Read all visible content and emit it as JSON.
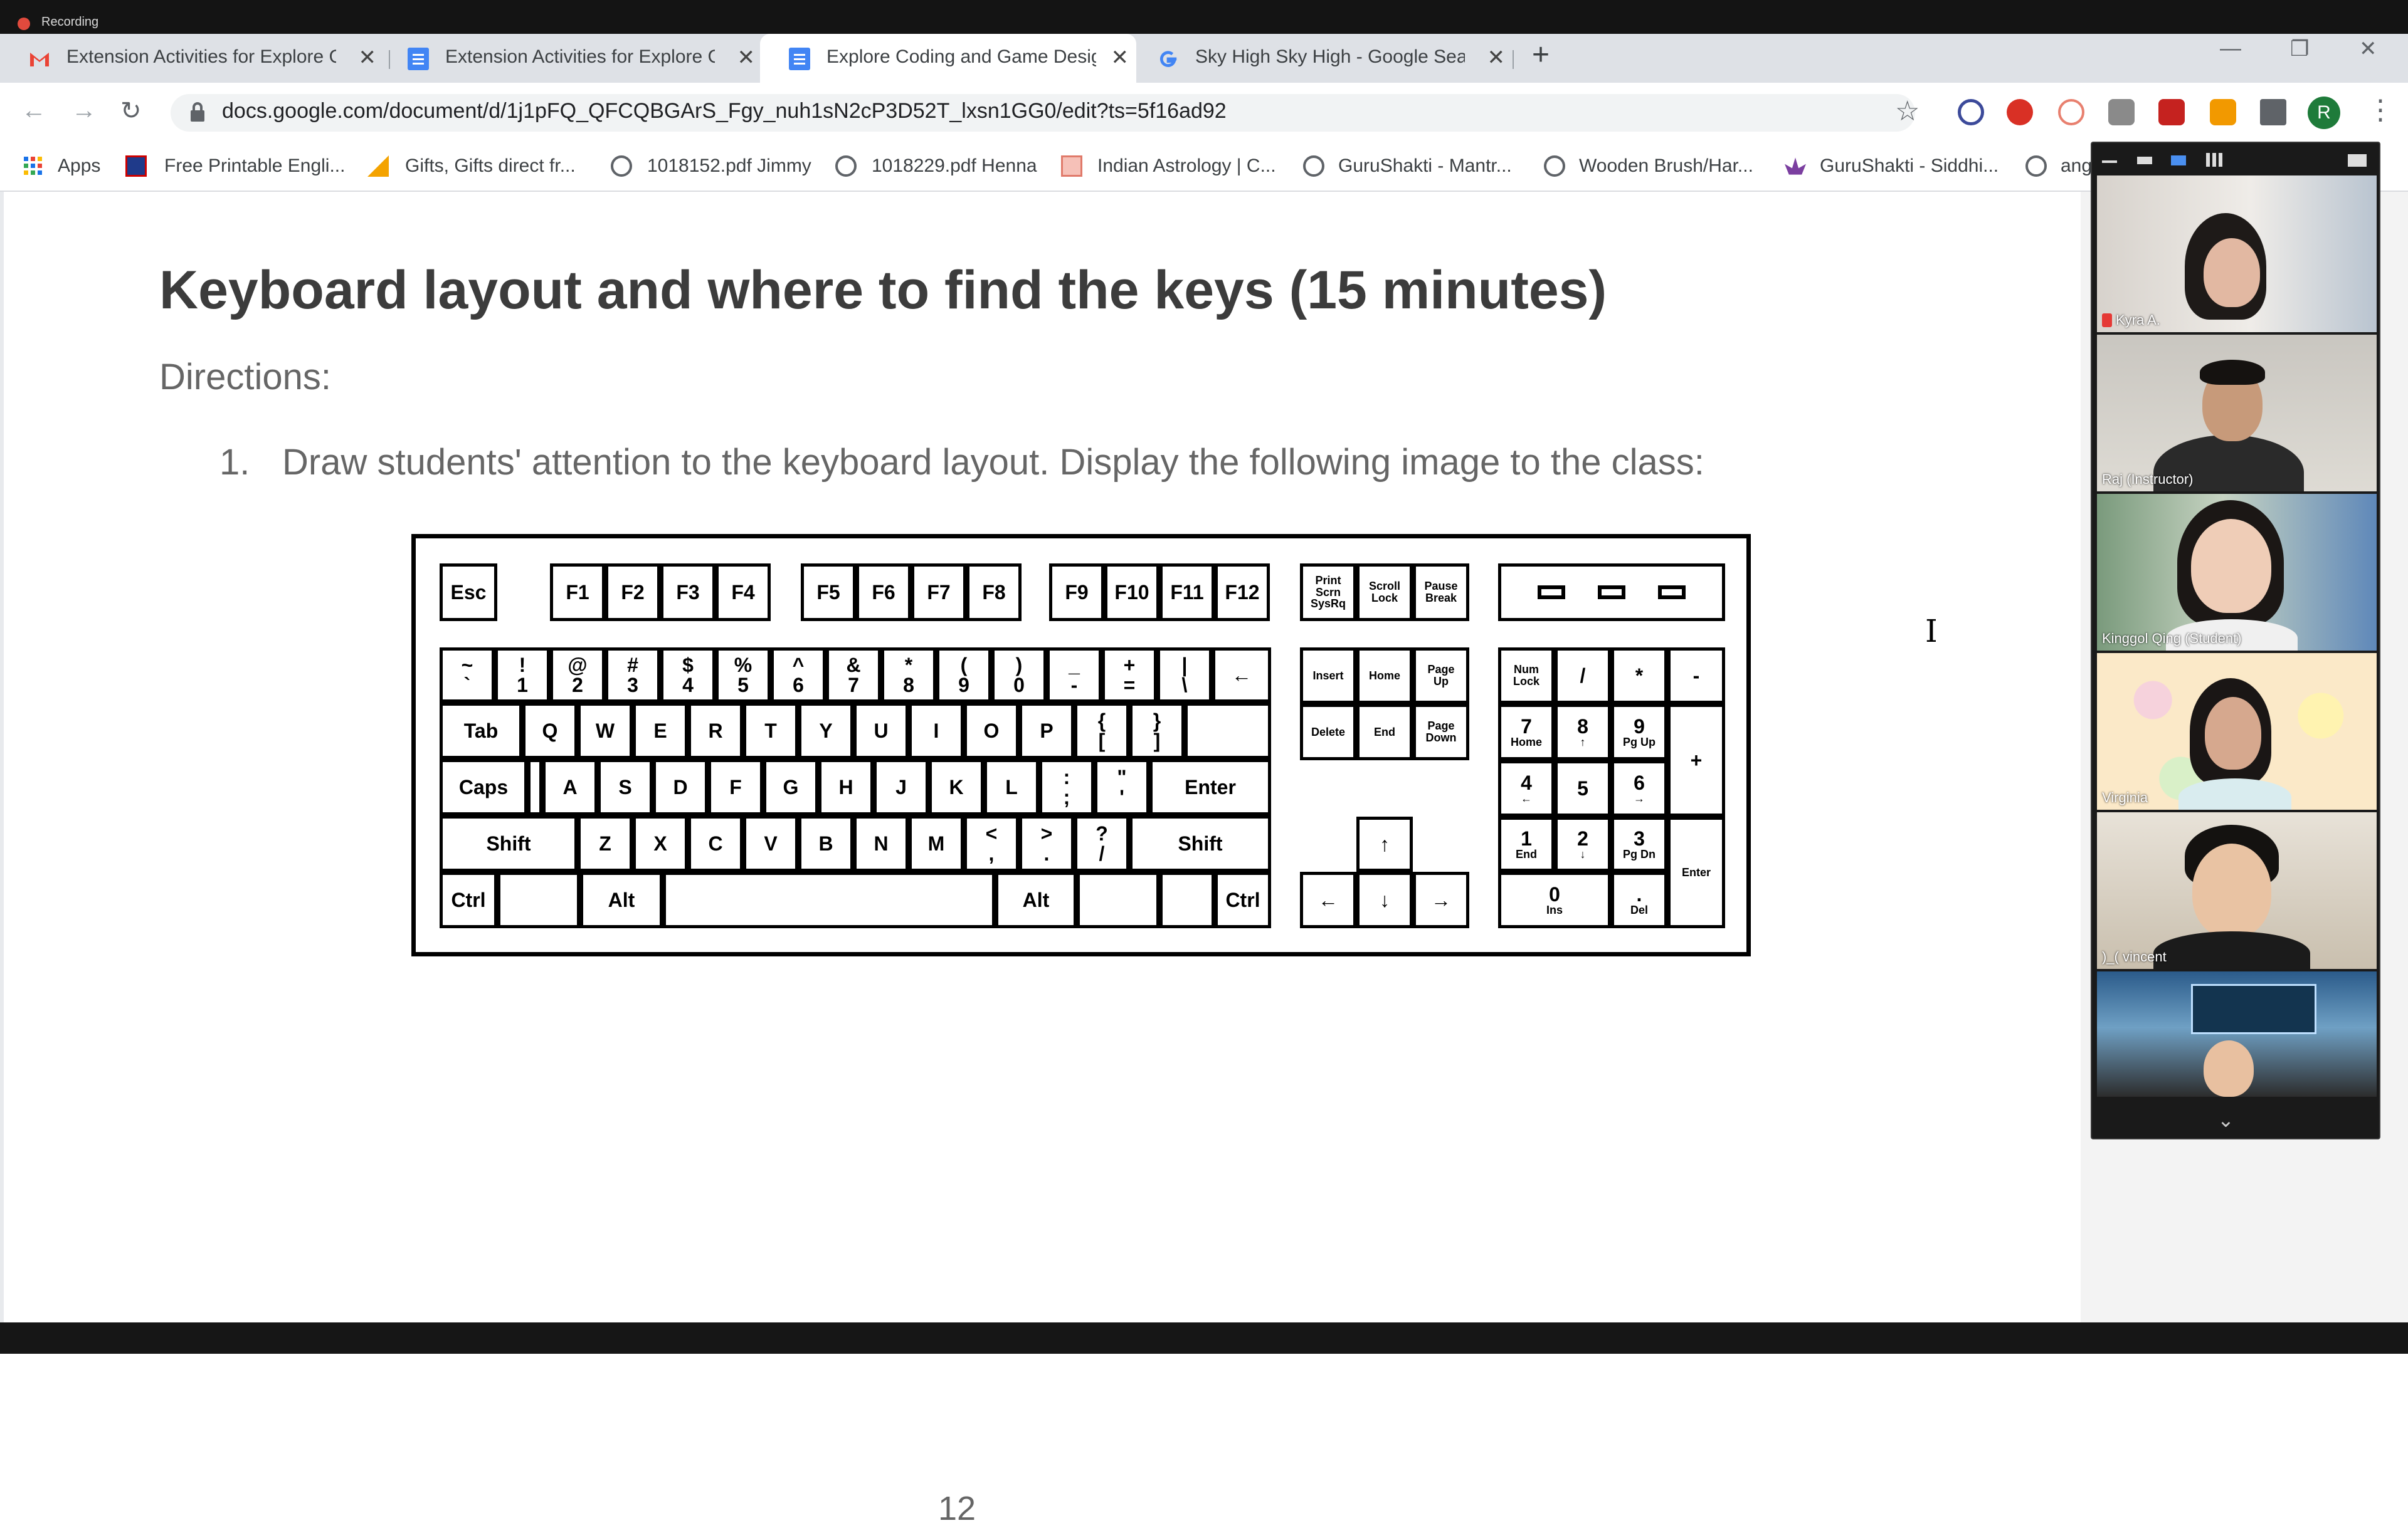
{
  "recording": {
    "label": "Recording"
  },
  "tabs": [
    {
      "title": "Extension Activities for Explore C",
      "icon": "gmail-icon",
      "active": false
    },
    {
      "title": "Extension Activities for Explore C",
      "icon": "docs-icon",
      "active": false
    },
    {
      "title": "Explore Coding and Game Desig",
      "icon": "docs-icon",
      "active": true
    },
    {
      "title": "Sky High Sky High - Google Sear",
      "icon": "google-icon",
      "active": false
    }
  ],
  "address_bar": {
    "url": "docs.google.com/document/d/1j1pFQ_QFCQBGArS_Fgy_nuh1sN2cP3D52T_lxsn1GG0/edit?ts=5f16ad92"
  },
  "profile": {
    "initial": "R"
  },
  "bookmarks": [
    {
      "label": "Apps",
      "icon": "apps-grid-icon"
    },
    {
      "label": "Free Printable Engli...",
      "icon": "flag-icon"
    },
    {
      "label": "Gifts, Gifts direct fr...",
      "icon": "gift-icon"
    },
    {
      "label": "1018152.pdf Jimmy",
      "icon": "globe-icon"
    },
    {
      "label": "1018229.pdf Henna",
      "icon": "globe-icon"
    },
    {
      "label": "Indian Astrology | C...",
      "icon": "astrology-icon"
    },
    {
      "label": "GuruShakti - Mantr...",
      "icon": "globe-icon"
    },
    {
      "label": "Wooden Brush/Har...",
      "icon": "globe-icon"
    },
    {
      "label": "GuruShakti - Siddhi...",
      "icon": "lotus-icon"
    },
    {
      "label": "ang",
      "icon": "globe-icon"
    }
  ],
  "document": {
    "title": "Keyboard layout and where to find the keys (15 minutes)",
    "directions": "Directions:",
    "item_number": "1.",
    "item_text": "Draw students' attention to the keyboard layout. Display the following image to the class:",
    "page_number": "12"
  },
  "keyboard": {
    "function_row": [
      "Esc",
      "F1",
      "F2",
      "F3",
      "F4",
      "F5",
      "F6",
      "F7",
      "F8",
      "F9",
      "F10",
      "F11",
      "F12"
    ],
    "system_keys": [
      [
        "Print",
        "Scrn",
        "SysRq"
      ],
      [
        "Scroll",
        "Lock"
      ],
      [
        "Pause",
        "Break"
      ]
    ],
    "number_row": [
      [
        "~",
        "`"
      ],
      [
        "!",
        "1"
      ],
      [
        "@",
        "2"
      ],
      [
        "#",
        "3"
      ],
      [
        "$",
        "4"
      ],
      [
        "%",
        "5"
      ],
      [
        "^",
        "6"
      ],
      [
        "&",
        "7"
      ],
      [
        "*",
        "8"
      ],
      [
        "(",
        "9"
      ],
      [
        ")",
        "0"
      ],
      [
        "_",
        "-"
      ],
      [
        "+",
        "="
      ],
      [
        "|",
        "\\"
      ]
    ],
    "backspace": "←",
    "tab": "Tab",
    "qwerty_row": [
      "Q",
      "W",
      "E",
      "R",
      "T",
      "Y",
      "U",
      "I",
      "O",
      "P"
    ],
    "brackets": [
      [
        "{",
        "["
      ],
      [
        "}",
        "]"
      ]
    ],
    "caps": "Caps",
    "home_row": [
      "A",
      "S",
      "D",
      "F",
      "G",
      "H",
      "J",
      "K",
      "L"
    ],
    "punct_home": [
      [
        ":",
        ";"
      ],
      [
        "\"",
        "'"
      ]
    ],
    "enter": "Enter",
    "shift": "Shift",
    "bottom_letters": [
      "Z",
      "X",
      "C",
      "V",
      "B",
      "N",
      "M"
    ],
    "punct_bottom": [
      [
        "<",
        ","
      ],
      [
        ">",
        "."
      ],
      [
        "?",
        "/"
      ]
    ],
    "ctrl": "Ctrl",
    "alt": "Alt",
    "nav_keys": [
      [
        "Insert"
      ],
      [
        "Home"
      ],
      [
        "Page",
        "Up"
      ],
      [
        "Delete"
      ],
      [
        "End"
      ],
      [
        "Page",
        "Down"
      ]
    ],
    "arrows": {
      "up": "↑",
      "left": "←",
      "down": "↓",
      "right": "→"
    },
    "numpad": {
      "numlock": [
        "Num",
        "Lock"
      ],
      "divide": "/",
      "multiply": "*",
      "minus": "-",
      "plus": "+",
      "k7": [
        "7",
        "Home"
      ],
      "k8": [
        "8",
        "↑"
      ],
      "k9": [
        "9",
        "Pg Up"
      ],
      "k4": [
        "4",
        "←"
      ],
      "k5": [
        "5"
      ],
      "k6": [
        "6",
        "→"
      ],
      "k1": [
        "1",
        "End"
      ],
      "k2": [
        "2",
        "↓"
      ],
      "k3": [
        "3",
        "Pg Dn"
      ],
      "k0": [
        "0",
        "Ins"
      ],
      "dot": [
        ".",
        "Del"
      ],
      "enter": "Enter"
    }
  },
  "participants": [
    {
      "name": "Kyra A.",
      "muted": true
    },
    {
      "name": "Raj (Instructor)"
    },
    {
      "name": "Kinggol Qing (Student)"
    },
    {
      "name": "Virginia"
    },
    {
      "name": ")_( vincent"
    },
    {
      "name": ""
    }
  ],
  "colors": {
    "accent": "#1a73e8",
    "docs_blue": "#4285f4",
    "gmail_red": "#ea4335"
  }
}
